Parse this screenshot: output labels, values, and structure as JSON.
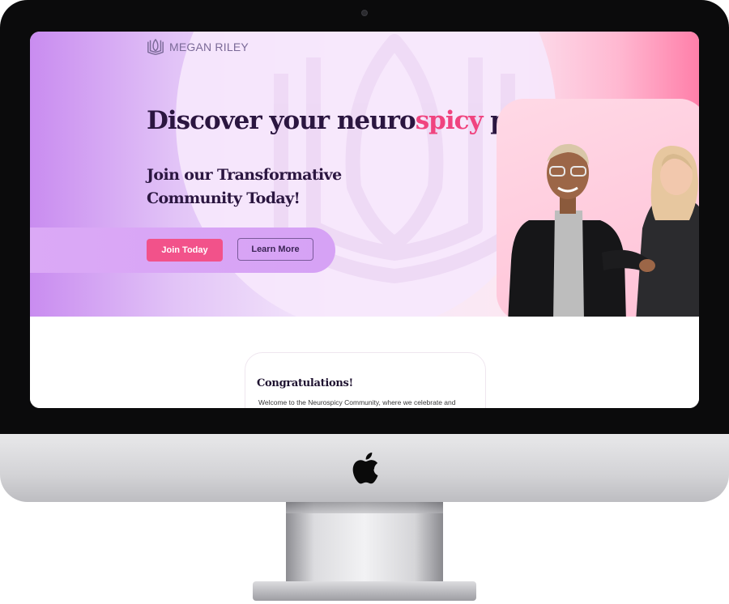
{
  "brand": {
    "name": "MEGAN RILEY",
    "logo_icon": "book-crest-icon"
  },
  "hero": {
    "headline_before": "Discover your neuro",
    "headline_accent": "spicy",
    "headline_after": " potential",
    "subheadline": "Join our Transformative Community Today!",
    "primary_cta": "Join Today",
    "secondary_cta": "Learn More",
    "image": "two-smiling-women-photo"
  },
  "card": {
    "title": "Congratulations!",
    "body": "Welcome to the Neurospicy Community, where we celebrate and"
  },
  "device": {
    "logo": "apple-icon"
  },
  "colors": {
    "accent_pink": "#f2528a",
    "heading_dark": "#2b1640",
    "gradient_purple": "#c98cf0",
    "gradient_pink": "#ff7fa9"
  }
}
